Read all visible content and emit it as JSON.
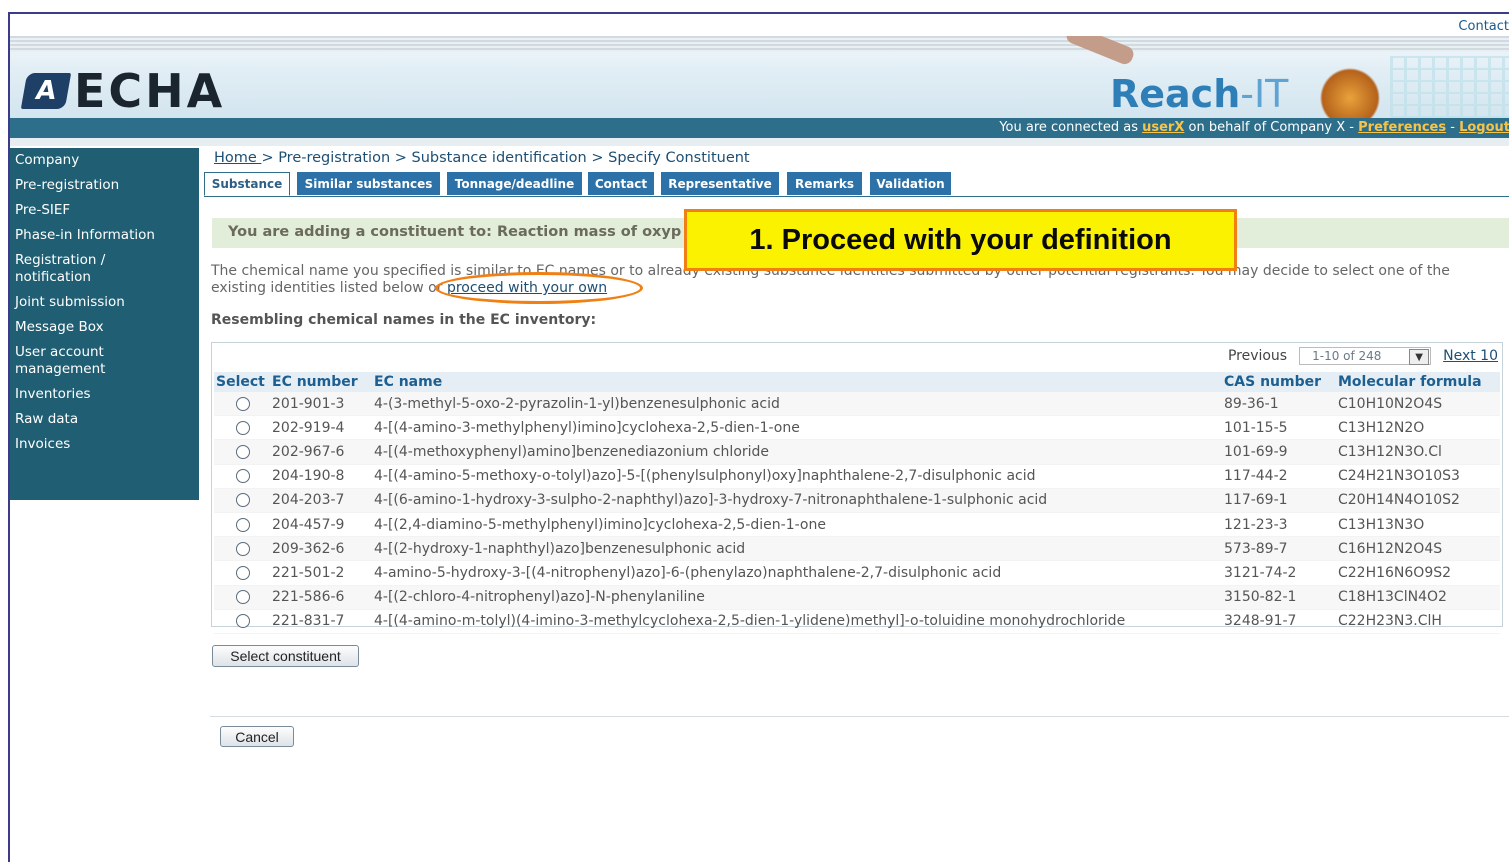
{
  "header": {
    "contact_link": "Contact",
    "logo_text": "ECHA",
    "reachit_a": "Reach",
    "reachit_b": "-IT",
    "status_prefix": "You are connected as ",
    "status_user": "userX",
    "status_middle": " on behalf of Company X - ",
    "status_preferences": "Preferences",
    "status_sep": " - ",
    "status_logout": "Logout"
  },
  "sidebar": {
    "items": [
      {
        "label": "Company"
      },
      {
        "label": "Pre-registration"
      },
      {
        "label": "Pre-SIEF"
      },
      {
        "label": "Phase-in Information"
      },
      {
        "label": "Registration / notification"
      },
      {
        "label": "Joint submission"
      },
      {
        "label": "Message Box"
      },
      {
        "label": "User account management"
      },
      {
        "label": "Inventories"
      },
      {
        "label": "Raw data"
      },
      {
        "label": "Invoices"
      }
    ]
  },
  "breadcrumb": {
    "home": "Home ",
    "rest": "> Pre-registration > Substance identification > Specify Constituent"
  },
  "tabs": [
    {
      "label": "Substance",
      "active": true
    },
    {
      "label": "Similar substances"
    },
    {
      "label": "Tonnage/deadline"
    },
    {
      "label": "Contact"
    },
    {
      "label": "Representative"
    },
    {
      "label": "Remarks"
    },
    {
      "label": "Validation"
    }
  ],
  "info_band": "You are adding a constituent to: Reaction mass of oxyp",
  "body": {
    "line1": "The chemical name you specified is similar to EC names or to already existing substance identities submitted by other potential registrants. You may decide to select one of the",
    "line2_prefix": "existing identities listed below ",
    "line2_or": "or ",
    "line2_link": "proceed with your own"
  },
  "resembling_heading": "Resembling chemical names in the EC inventory:",
  "pager": {
    "previous": "Previous",
    "range": "1-10 of 248",
    "next": "Next 10"
  },
  "table": {
    "headers": [
      "Select",
      "EC number",
      "EC name",
      "CAS number",
      "Molecular formula"
    ],
    "rows": [
      [
        "201-901-3",
        "4-(3-methyl-5-oxo-2-pyrazolin-1-yl)benzenesulphonic acid",
        "89-36-1",
        "C10H10N2O4S"
      ],
      [
        "202-919-4",
        "4-[(4-amino-3-methylphenyl)imino]cyclohexa-2,5-dien-1-one",
        "101-15-5",
        "C13H12N2O"
      ],
      [
        "202-967-6",
        "4-[(4-methoxyphenyl)amino]benzenediazonium chloride",
        "101-69-9",
        "C13H12N3O.Cl"
      ],
      [
        "204-190-8",
        "4-[(4-amino-5-methoxy-o-tolyl)azo]-5-[(phenylsulphonyl)oxy]naphthalene-2,7-disulphonic acid",
        "117-44-2",
        "C24H21N3O10S3"
      ],
      [
        "204-203-7",
        "4-[(6-amino-1-hydroxy-3-sulpho-2-naphthyl)azo]-3-hydroxy-7-nitronaphthalene-1-sulphonic acid",
        "117-69-1",
        "C20H14N4O10S2"
      ],
      [
        "204-457-9",
        "4-[(2,4-diamino-5-methylphenyl)imino]cyclohexa-2,5-dien-1-one",
        "121-23-3",
        "C13H13N3O"
      ],
      [
        "209-362-6",
        "4-[(2-hydroxy-1-naphthyl)azo]benzenesulphonic acid",
        "573-89-7",
        "C16H12N2O4S"
      ],
      [
        "221-501-2",
        "4-amino-5-hydroxy-3-[(4-nitrophenyl)azo]-6-(phenylazo)naphthalene-2,7-disulphonic acid",
        "3121-74-2",
        "C22H16N6O9S2"
      ],
      [
        "221-586-6",
        "4-[(2-chloro-4-nitrophenyl)azo]-N-phenylaniline",
        "3150-82-1",
        "C18H13ClN4O2"
      ],
      [
        "221-831-7",
        "4-[(4-amino-m-tolyl)(4-imino-3-methylcyclohexa-2,5-dien-1-ylidene)methyl]-o-toluidine monohydrochloride",
        "3248-91-7",
        "C22H23N3.ClH"
      ]
    ]
  },
  "buttons": {
    "select_constituent": "Select constituent",
    "cancel": "Cancel"
  },
  "callout": "1. Proceed with your definition",
  "colors": {
    "sidebar": "#1f5e73",
    "tab": "#2c72a8",
    "callout_fill": "#fbf200",
    "callout_border": "#f08014"
  }
}
